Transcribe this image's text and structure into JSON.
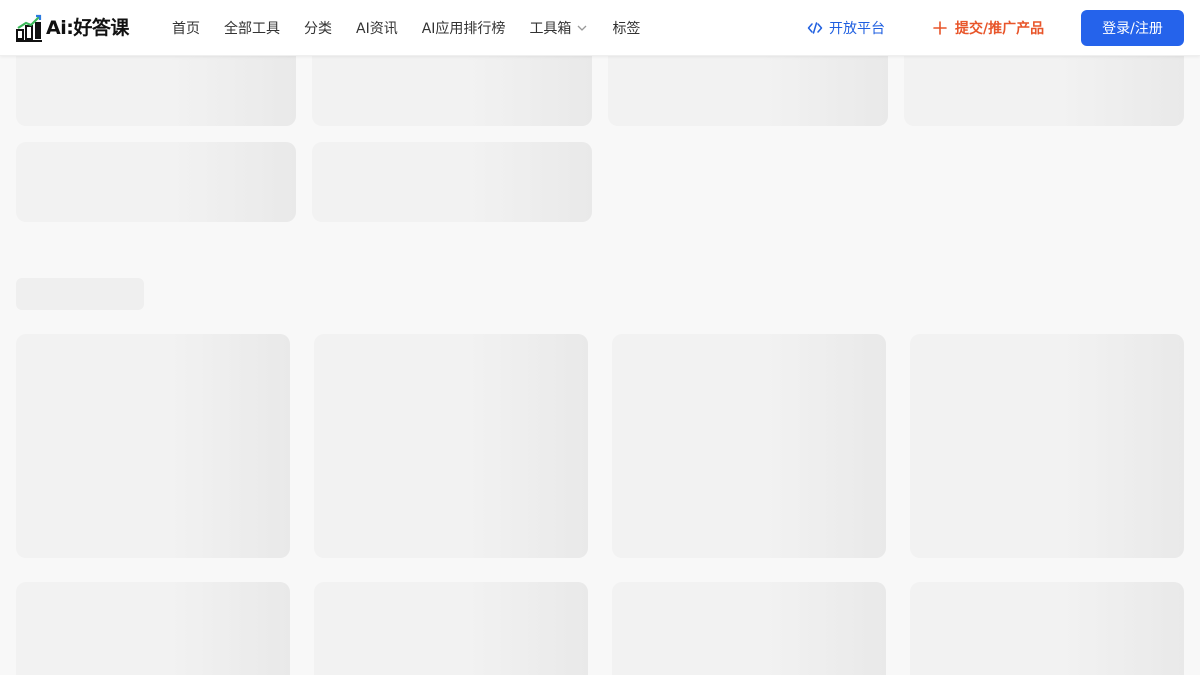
{
  "brand": {
    "logo_text": "Ai:好答课",
    "colors": {
      "accent": "#2563eb",
      "promo": "#e8552a",
      "link": "#1f5fe0",
      "logo_green": "#3cb95a",
      "logo_blue": "#2b7be0"
    }
  },
  "nav": {
    "items": [
      "首页",
      "全部工具",
      "分类",
      "AI资讯",
      "AI应用排行榜",
      "工具箱",
      "标签"
    ],
    "dropdown_icon": "chevron-down-icon"
  },
  "actions": {
    "open_platform": "开放平台",
    "open_platform_icon": "code-icon",
    "submit": "提交/推广产品",
    "submit_icon": "plus-icon",
    "login": "登录/注册"
  }
}
